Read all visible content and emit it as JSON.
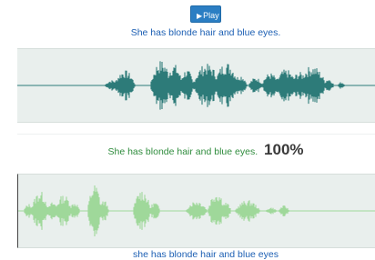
{
  "player": {
    "play_icon": "play-icon",
    "play_label": "Play",
    "button_color": "#2b7ec3"
  },
  "reference": {
    "sentence": "She has blonde hair and blue eyes.",
    "wave_color": "#2d7b79"
  },
  "result": {
    "sentence": "She has blonde hair and blue eyes.",
    "score": "100%",
    "sentence_color": "#2f8c3d"
  },
  "recording": {
    "wave_color": "#9fd89a",
    "transcript": "she has blonde hair and blue eyes"
  }
}
